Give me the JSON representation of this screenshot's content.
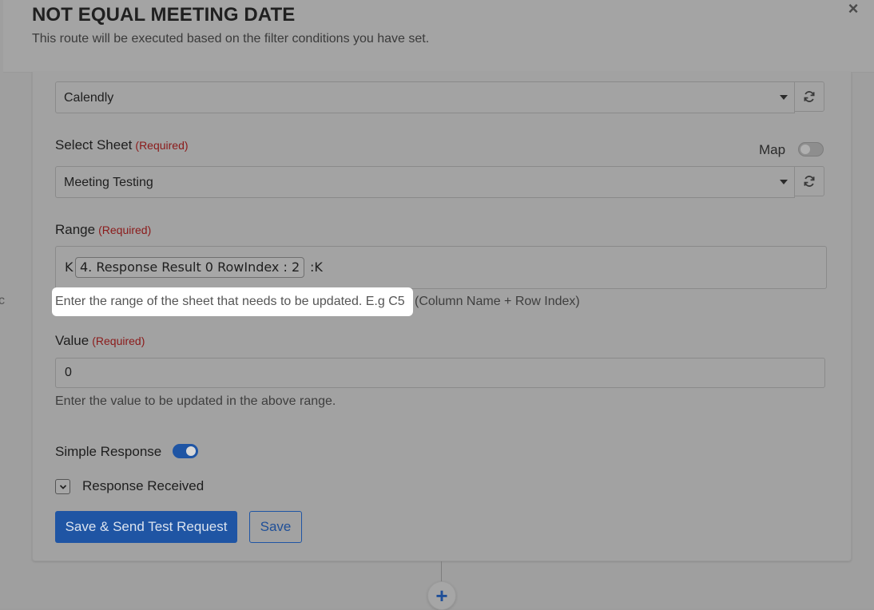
{
  "modal": {
    "title": "NOT EQUAL MEETING DATE",
    "subtitle": "This route will be executed based on the filter conditions you have set.",
    "close_glyph": "×"
  },
  "spreadsheet_select": {
    "value": "Calendly"
  },
  "sheet_field": {
    "label": "Select Sheet",
    "required": "(Required)",
    "value": "Meeting Testing",
    "map_label": "Map",
    "map_enabled": false
  },
  "range_field": {
    "label": "Range",
    "required": "(Required)",
    "prefix": "K",
    "chip": "4. Response Result 0 RowIndex : 2",
    "suffix": ":K",
    "help_highlight": "Enter the range of the sheet that needs to be updated. E.g C5",
    "help_rest": "(Column Name + Row Index)"
  },
  "value_field": {
    "label": "Value",
    "required": "(Required)",
    "value": "0",
    "help": "Enter the value to be updated in the above range."
  },
  "simple_response": {
    "label": "Simple Response",
    "enabled": true
  },
  "response_received": {
    "label": "Response Received"
  },
  "buttons": {
    "save_send": "Save & Send Test Request",
    "save": "Save",
    "add_step": "+"
  },
  "colors": {
    "primary": "#1f55a4",
    "required": "#8b1a1a",
    "overlay": "#9f9f9f"
  }
}
